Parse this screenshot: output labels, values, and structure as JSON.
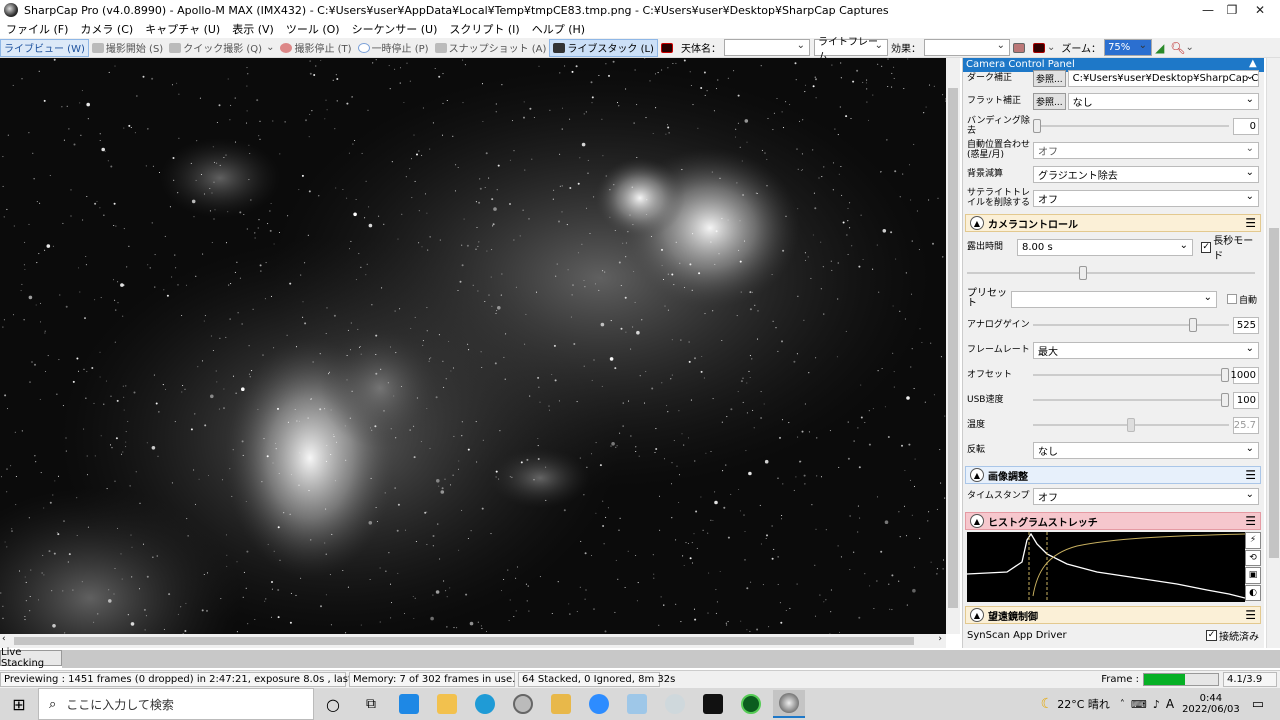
{
  "window": {
    "title": "SharpCap Pro (v4.0.8990) - Apollo-M MAX (IMX432) - C:¥Users¥user¥AppData¥Local¥Temp¥tmpCE83.tmp.png - C:¥Users¥user¥Desktop¥SharpCap Captures",
    "minimize": "—",
    "maximize": "❐",
    "close": "✕"
  },
  "menu": [
    "ファイル (F)",
    "カメラ (C)",
    "キャプチャ (U)",
    "表示 (V)",
    "ツール (O)",
    "シーケンサー (U)",
    "スクリプト (I)",
    "ヘルプ (H)"
  ],
  "toolbar": {
    "live_view": "ライブビュー (W)",
    "start_capture": "撮影開始 (S)",
    "quick_capture": "クイック撮影 (Q)",
    "stop_capture": "撮影停止 (T)",
    "pause": "一時停止 (P)",
    "snapshot": "スナップショット (A)",
    "live_stack": "ライブスタック (L)",
    "target_label": "天体名：",
    "target_value": "",
    "frame_mode": "ライトフレーム",
    "effect_label": "効果：",
    "effect_value": "",
    "zoom_label": "ズーム：",
    "zoom_value": "75%"
  },
  "panel": {
    "header": "Camera Control Panel",
    "dark_label": "ダーク補正",
    "dark_btn": "参照...",
    "dark_value": "C:¥Users¥user¥Desktop¥SharpCap Capt...",
    "flat_label": "フラット補正",
    "flat_btn": "参照...",
    "flat_value": "なし",
    "banding_label": "バンディング除去",
    "banding_value": "0",
    "banding_level": 0.0,
    "align_label": "自動位置合わせ (惑星/月)",
    "align_value": "オフ",
    "bg_label": "背景減算",
    "bg_value": "グラジエント除去",
    "sat_label": "サテライトトレイルを削除する",
    "sat_value": "オフ",
    "camera_section": "カメラコントロール",
    "exposure_label": "露出時間",
    "exposure_value": "8.00 s",
    "long_exposure": "長秒モード",
    "exposure_level": 0.4,
    "preset_label": "プリセット",
    "preset_value": "",
    "auto_label": "自動",
    "gain_label": "アナログゲイン",
    "gain_value": "525",
    "gain_level": 0.83,
    "framerate_label": "フレームレート",
    "framerate_value": "最大",
    "offset_label": "オフセット",
    "offset_value": "1000",
    "offset_level": 1.0,
    "usb_label": "USB速度",
    "usb_value": "100",
    "usb_level": 1.0,
    "temp_label": "温度",
    "temp_value": "25.7",
    "temp_level": 0.5,
    "flip_label": "反転",
    "flip_value": "なし",
    "image_section": "画像調整",
    "timestamp_label": "タイムスタンプ",
    "timestamp_value": "オフ",
    "histo_section": "ヒストグラムストレッチ",
    "scope_section": "望遠鏡制御",
    "scope_driver": "SynScan App Driver",
    "scope_connected": "接続済み"
  },
  "tab": "Live Stacking",
  "status": {
    "preview": "Previewing : 1451 frames (0 dropped) in 2:47:21, exposure 8.0s , last frame 8.1s",
    "memory": "Memory: 7 of 302 frames in use.",
    "stacked": "64 Stacked, 0 Ignored, 8m 32s",
    "frame_label": "Frame :",
    "frame_time": "4.1/3.9",
    "frame_progress": 0.55
  },
  "taskbar": {
    "search_placeholder": "ここに入力して検索",
    "weather": "22°C  晴れ",
    "time": "0:44",
    "date": "2022/06/03",
    "ime": "A"
  }
}
